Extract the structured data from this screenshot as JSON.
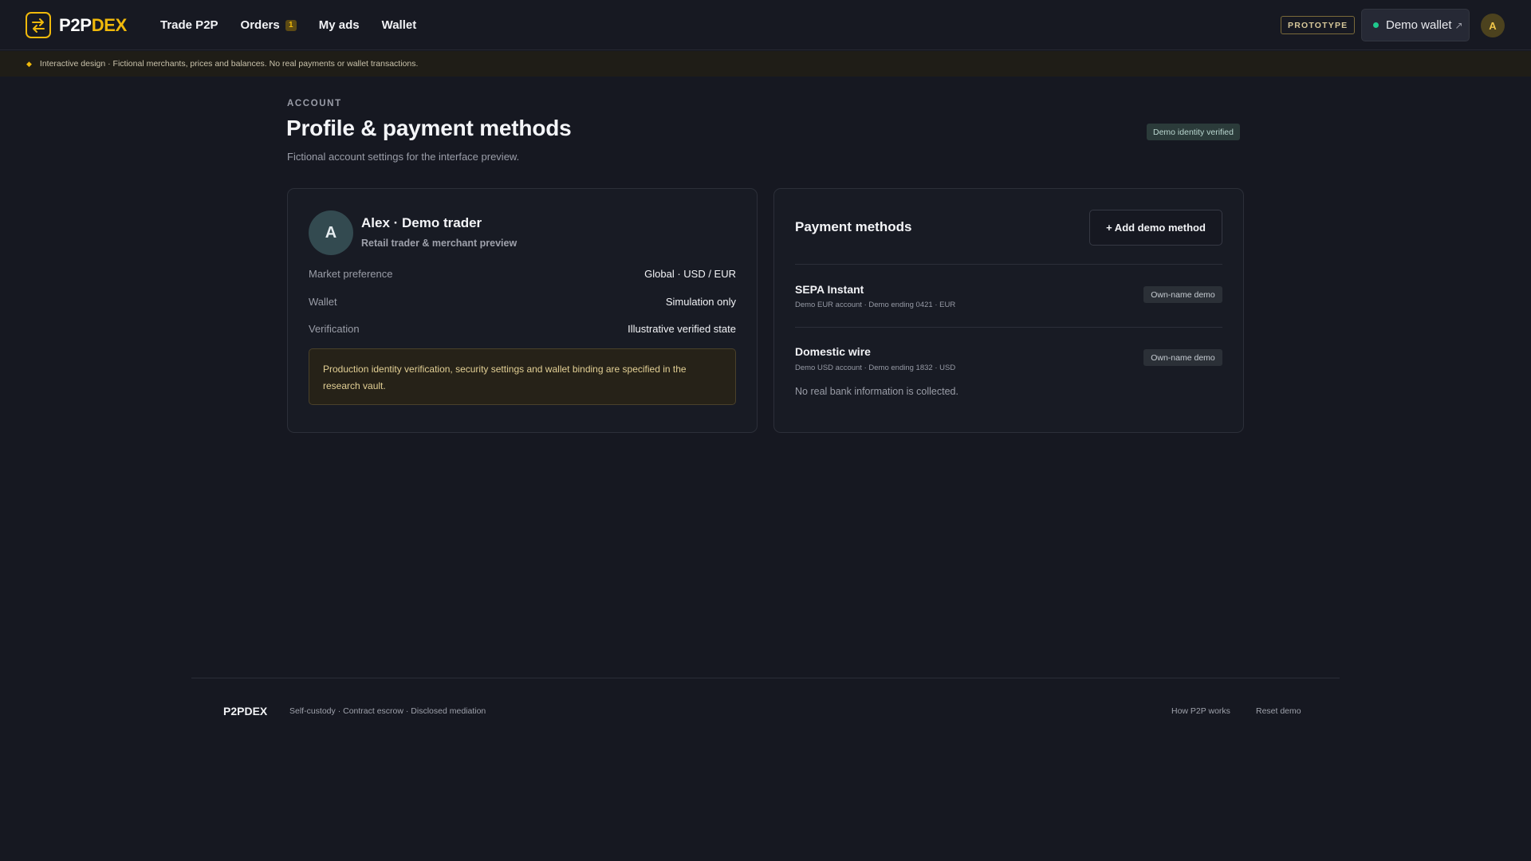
{
  "header": {
    "logo": {
      "part1": "P2P",
      "part2": "DEX"
    },
    "nav": [
      {
        "label": "Trade P2P"
      },
      {
        "label": "Orders",
        "badge": "1"
      },
      {
        "label": "My ads"
      },
      {
        "label": "Wallet"
      }
    ],
    "prototype_label": "PROTOTYPE",
    "wallet_label": "Demo wallet",
    "wallet_arrow": "↗",
    "avatar_initial": "A"
  },
  "notice": {
    "text": "Interactive design · Fictional merchants, prices and balances. No real payments or wallet transactions."
  },
  "page": {
    "eyebrow": "ACCOUNT",
    "title": "Profile & payment methods",
    "subtitle": "Fictional account settings for the interface preview.",
    "verified_badge": "Demo identity verified"
  },
  "profile": {
    "avatar_initial": "A",
    "name": "Alex · Demo trader",
    "role": "Retail trader & merchant preview",
    "rows": [
      {
        "label": "Market preference",
        "value": "Global · USD / EUR"
      },
      {
        "label": "Wallet",
        "value": "Simulation only"
      },
      {
        "label": "Verification",
        "value": "Illustrative verified state"
      }
    ],
    "warning": "Production identity verification, security settings and wallet binding are specified in the research vault."
  },
  "payment_methods": {
    "title": "Payment methods",
    "add_button": "+ Add demo method",
    "items": [
      {
        "name": "SEPA Instant",
        "detail": "Demo EUR account · Demo ending 0421 · EUR",
        "badge": "Own-name demo"
      },
      {
        "name": "Domestic wire",
        "detail": "Demo USD account · Demo ending 1832 · USD",
        "badge": "Own-name demo"
      }
    ],
    "note": "No real bank information is collected."
  },
  "footer": {
    "logo": "P2PDEX",
    "tagline": "Self-custody · Contract escrow · Disclosed mediation",
    "links": [
      "How P2P works",
      "Reset demo"
    ]
  },
  "colors": {
    "background": "#161821",
    "accent": "#f0b90b",
    "success": "#1fc98d"
  }
}
